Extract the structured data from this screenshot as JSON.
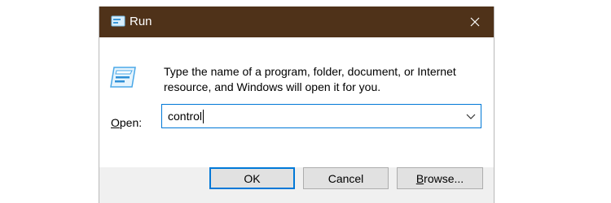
{
  "window": {
    "title": "Run",
    "title_icon": "run-app-icon",
    "close_icon": "close-icon",
    "titlebar_color": "#4f3219"
  },
  "content": {
    "icon": "run-dialog-icon",
    "description_line1": "Type the name of a program, folder, document, or Internet",
    "description_line2": "resource, and Windows will open it for you.",
    "open_label_accel": "O",
    "open_label_rest": "pen:",
    "open_value": "control",
    "dropdown_icon": "chevron-down-icon"
  },
  "buttons": {
    "ok": "OK",
    "cancel": "Cancel",
    "browse_accel": "B",
    "browse_rest": "rowse..."
  },
  "colors": {
    "focus_border": "#0078d7",
    "button_bg": "#e1e1e1",
    "footer_bg": "#f0f0f0"
  }
}
